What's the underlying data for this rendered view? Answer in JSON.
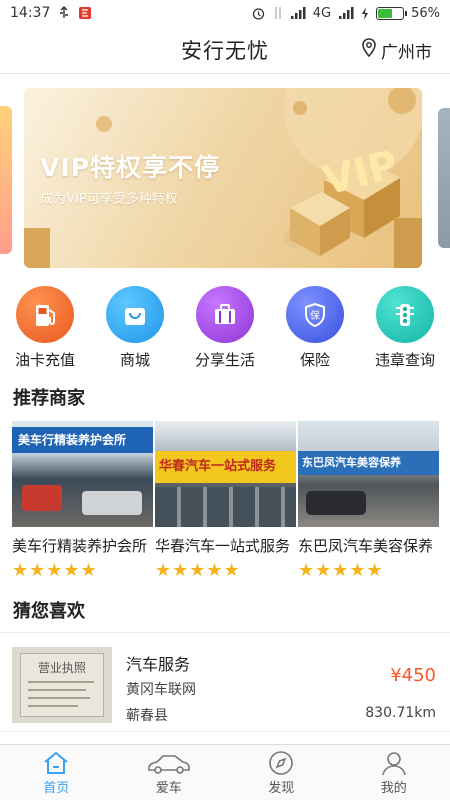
{
  "status_bar": {
    "time": "14:37",
    "network": "4G",
    "battery": "56%",
    "battery_level": 0.56
  },
  "header": {
    "title": "安行无忧",
    "city": "广州市"
  },
  "banner": {
    "title": "VIP特权享不停",
    "subtitle": "成为VIP可享受多种特权",
    "badge": "VIP"
  },
  "quick_menu": [
    {
      "label": "油卡充值",
      "icon": "fuel-pump-icon",
      "color": "#f06a2b"
    },
    {
      "label": "商城",
      "icon": "shopping-bag-icon",
      "color": "#32a9ef"
    },
    {
      "label": "分享生活",
      "icon": "briefcase-icon",
      "color": "#a34de0"
    },
    {
      "label": "保险",
      "icon": "shield-icon",
      "color": "#4c67ee"
    },
    {
      "label": "违章查询",
      "icon": "traffic-light-icon",
      "color": "#1fc7b8"
    }
  ],
  "sections": {
    "recommended": "推荐商家",
    "guess": "猜您喜欢"
  },
  "merchants": [
    {
      "name": "美车行精装养护会所",
      "rating": 5,
      "sign": "美车行精装养护会所"
    },
    {
      "name": "华春汽车一站式服务",
      "rating": 5,
      "sign": "华春汽车一站式服务"
    },
    {
      "name": "东巴凤汽车美容保养",
      "rating": 5,
      "sign": "东巴凤汽车美容保养"
    }
  ],
  "recommendation": {
    "title": "汽车服务",
    "company": "黄冈车联网",
    "region": "蕲春县",
    "price": "¥450",
    "distance": "830.71km",
    "photo_text": "营业执照"
  },
  "tabs": [
    {
      "label": "首页",
      "icon": "home-icon",
      "active": true
    },
    {
      "label": "爱车",
      "icon": "car-icon",
      "active": false
    },
    {
      "label": "发现",
      "icon": "compass-icon",
      "active": false
    },
    {
      "label": "我的",
      "icon": "user-icon",
      "active": false
    }
  ]
}
